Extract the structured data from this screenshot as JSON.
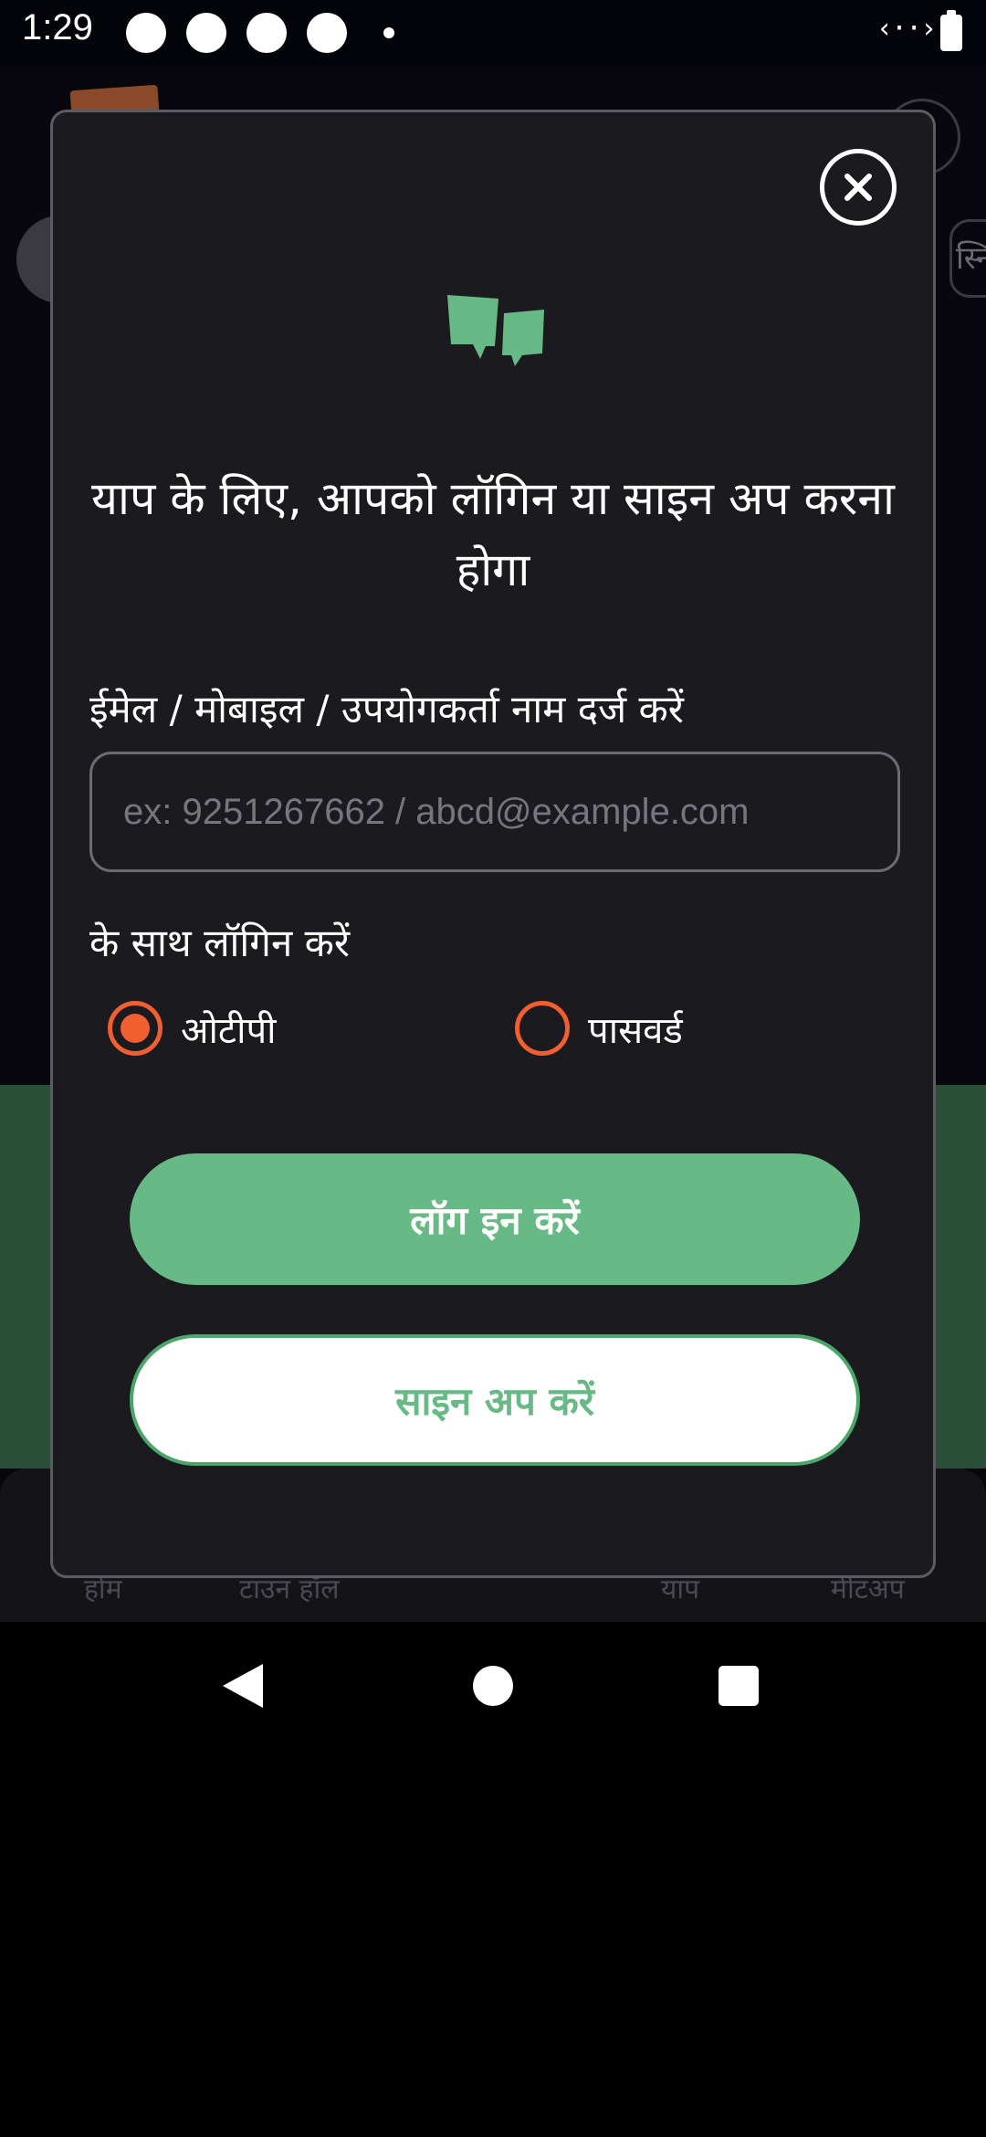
{
  "status_bar": {
    "time": "1:29",
    "data_indicator": "‹··›!"
  },
  "background": {
    "chip_text": "स्नि",
    "bottom_nav": [
      "होम",
      "टाउन हॉल",
      "याप",
      "मीटअप"
    ]
  },
  "modal": {
    "heading": "याप के लिए, आपको लॉगिन या साइन अप करना होगा",
    "field_label": "ईमेल / मोबाइल / उपयोगकर्ता नाम दर्ज करें",
    "input_placeholder": "ex: 9251267662 / abcd@example.com",
    "input_value": "",
    "login_with_label": "के साथ लॉगिन करें",
    "options": [
      {
        "label": "ओटीपी",
        "selected": true
      },
      {
        "label": "पासवर्ड",
        "selected": false
      }
    ],
    "login_button": "लॉग इन करें",
    "signup_button": "साइन अप करें"
  },
  "icons": {
    "close": "close-icon",
    "logo": "chat-bubbles-logo-icon",
    "nav_back": "back-triangle-icon",
    "nav_home": "home-circle-icon",
    "nav_recents": "recents-square-icon"
  },
  "colors": {
    "accent_green": "#67b985",
    "radio_orange": "#ef5f2f",
    "modal_bg": "#1b1a1f"
  }
}
